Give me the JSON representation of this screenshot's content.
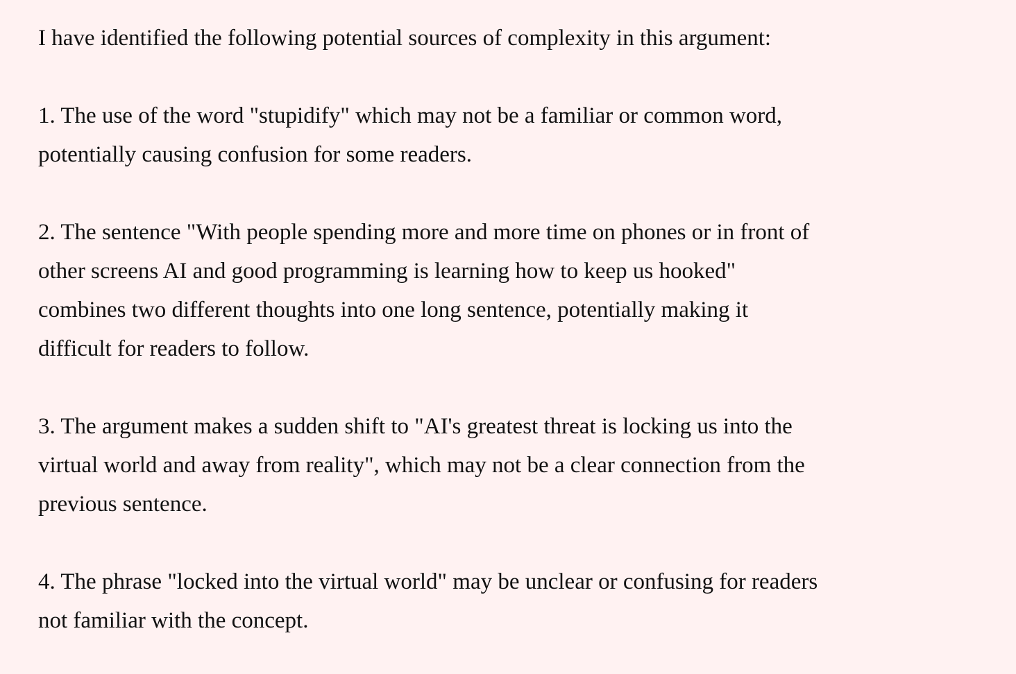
{
  "document": {
    "intro": "I have identified the following potential sources of complexity in this argument:",
    "items": [
      "1. The use of the word \"stupidify\" which may not be a familiar or common word,\npotentially causing confusion for some readers.",
      "2. The sentence \"With people spending more and more time on phones or in front of\nother screens AI and good programming is learning how to keep us hooked\"\ncombines two different thoughts into one long sentence, potentially making it\ndifficult for readers to follow.",
      "3. The argument makes a sudden shift to \"AI's greatest threat is locking us into the\nvirtual world and away from reality\", which may not be a clear connection from the\nprevious sentence.",
      "4. The phrase \"locked into the virtual world\" may be unclear or confusing for readers\nnot familiar with the concept."
    ]
  }
}
